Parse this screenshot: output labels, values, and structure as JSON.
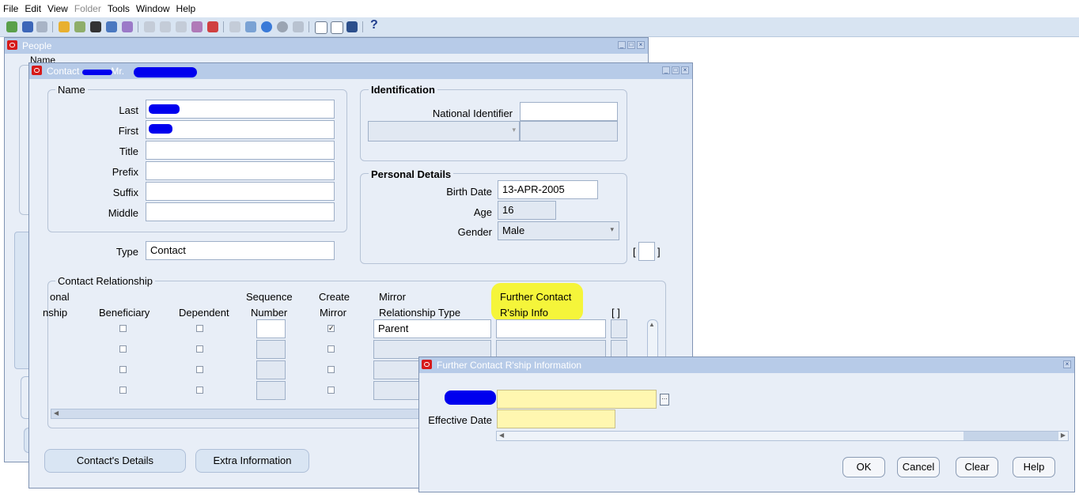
{
  "menu": [
    "File",
    "Edit",
    "View",
    "Folder",
    "Tools",
    "Window",
    "Help"
  ],
  "toolbar": {
    "help": "?"
  },
  "people_window": {
    "title": "People",
    "partial_label": "Name"
  },
  "contact_window": {
    "title_prefix": "Contact",
    "title_mid": "Mr.",
    "name_group": {
      "title": "Name",
      "fields": [
        {
          "label": "Last",
          "value": ""
        },
        {
          "label": "First",
          "value": ""
        },
        {
          "label": "Title",
          "value": ""
        },
        {
          "label": "Prefix",
          "value": ""
        },
        {
          "label": "Suffix",
          "value": ""
        },
        {
          "label": "Middle",
          "value": ""
        }
      ]
    },
    "type": {
      "label": "Type",
      "value": "Contact"
    },
    "identification": {
      "title": "Identification",
      "national_identifier_label": "National Identifier",
      "national_identifier_value": ""
    },
    "personal_details": {
      "title": "Personal Details",
      "birth_date_label": "Birth Date",
      "birth_date": "13-APR-2005",
      "age_label": "Age",
      "age": "16",
      "gender_label": "Gender",
      "gender": "Male"
    },
    "bracket_left": "[",
    "bracket_right": "]",
    "relationship": {
      "title": "Contact Relationship",
      "col_partial_1": "onal",
      "col_partial_2": "nship",
      "col_beneficiary": "Beneficiary",
      "col_dependent": "Dependent",
      "col_sequence_1": "Sequence",
      "col_sequence_2": "Number",
      "col_create_1": "Create",
      "col_create_2": "Mirror",
      "col_mirror_1": "Mirror",
      "col_mirror_2": "Relationship Type",
      "col_further_1": "Further Contact",
      "col_further_2": "R'ship Info",
      "col_bracket": "[ ]",
      "row1_mirror_type": "Parent"
    },
    "buttons": {
      "contact_details": "Contact's Details",
      "extra_information": "Extra Information"
    }
  },
  "further_window": {
    "title": "Further Contact R'ship Information",
    "effective_date_label": "Effective Date",
    "buttons": {
      "ok": "OK",
      "cancel": "Cancel",
      "clear": "Clear",
      "help": "Help"
    }
  },
  "colors": {
    "title_bar": "#b7cbe8",
    "window_bg": "#e8eef7",
    "highlight": "#f5f53a",
    "redaction": "#0000ee",
    "required_field": "#fff7b0"
  }
}
